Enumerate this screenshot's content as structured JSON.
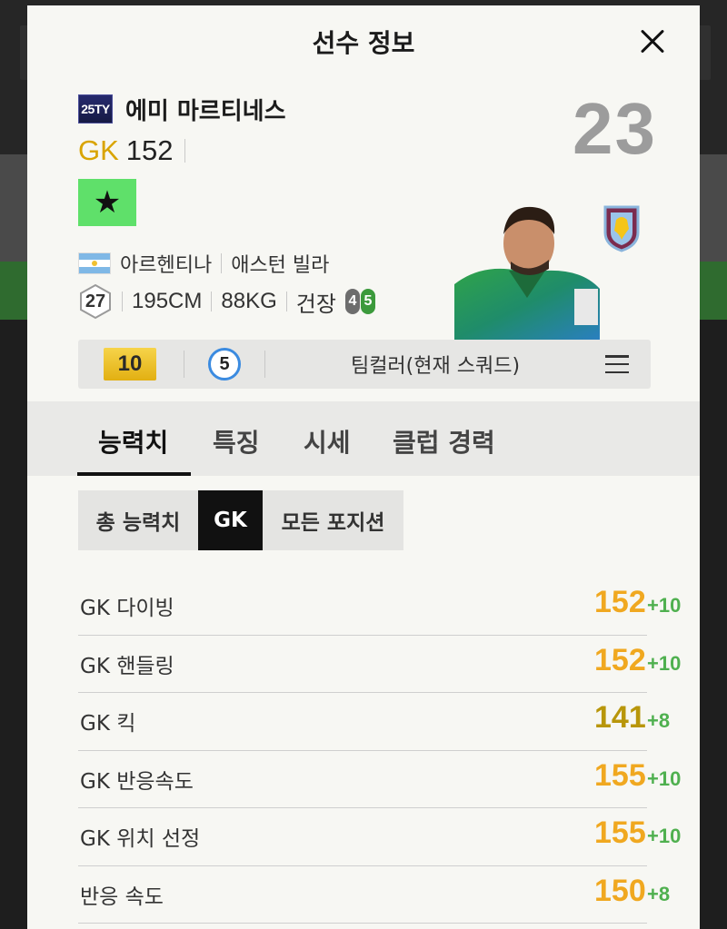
{
  "header": {
    "title": "선수 정보"
  },
  "player": {
    "season_badge": "25TY",
    "name": "에미 마르티네스",
    "position": "GK",
    "ovr": "152",
    "shirt_number": "23",
    "nation": "아르헨티나",
    "club": "애스턴 빌라",
    "age": "27",
    "height": "195CM",
    "weight": "88KG",
    "build": "건장",
    "skill_left": "4",
    "skill_right": "5",
    "star_icon": "★"
  },
  "enhance": {
    "grade": "10",
    "level": "5",
    "team_color": "팀컬러(현재 스쿼드)"
  },
  "tabs": [
    {
      "label": "능력치"
    },
    {
      "label": "특징"
    },
    {
      "label": "시세"
    },
    {
      "label": "클럽 경력"
    }
  ],
  "subtabs": [
    {
      "label": "총 능력치"
    },
    {
      "label": "GK"
    },
    {
      "label": "모든 포지션"
    }
  ],
  "attributes": [
    {
      "name": "GK 다이빙",
      "value": "152",
      "bonus": "+10",
      "color": "#f0a820"
    },
    {
      "name": "GK 핸들링",
      "value": "152",
      "bonus": "+10",
      "color": "#f0a820"
    },
    {
      "name": "GK 킥",
      "value": "141",
      "bonus": "+8",
      "color": "#b8960a"
    },
    {
      "name": "GK 반응속도",
      "value": "155",
      "bonus": "+10",
      "color": "#f0a820"
    },
    {
      "name": "GK 위치 선정",
      "value": "155",
      "bonus": "+10",
      "color": "#f0a820"
    },
    {
      "name": "반응 속도",
      "value": "150",
      "bonus": "+8",
      "color": "#f0a820"
    }
  ],
  "colors": {
    "accent_gk": "#d9a400",
    "bonus_green": "#4fb04f",
    "star_badge": "#5fe06a"
  }
}
